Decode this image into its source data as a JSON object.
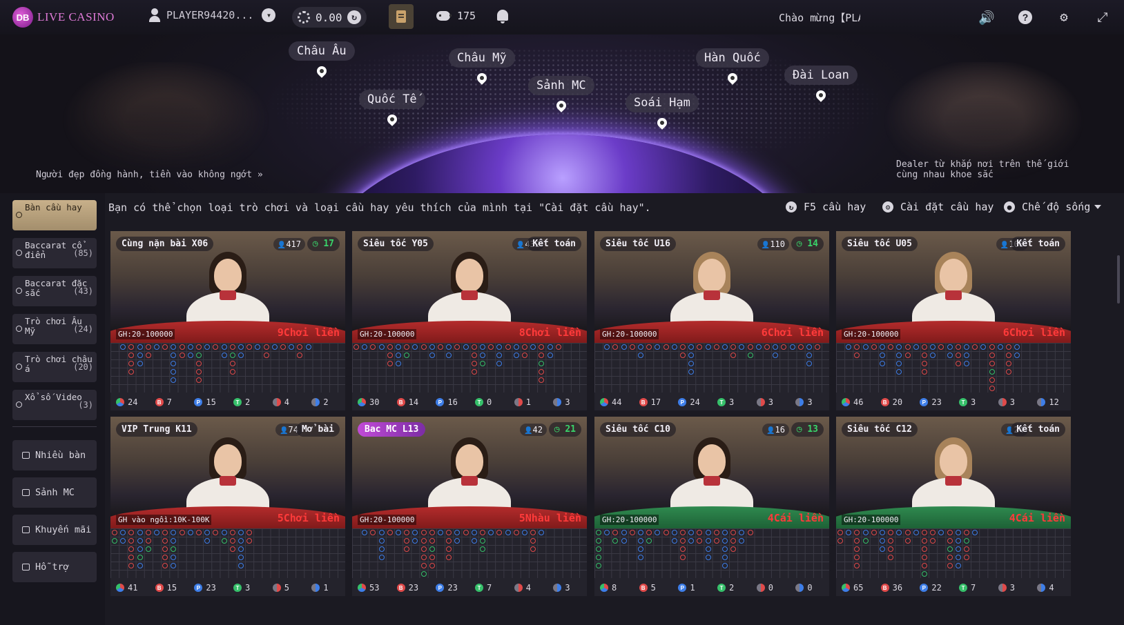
{
  "brand": {
    "logo_mark": "DB",
    "name": "LIVE CASINO"
  },
  "header": {
    "player": "PLAYER94420...",
    "balance": "0.00",
    "messages": "175",
    "welcome": "Chào mừng【PLA"
  },
  "hero": {
    "left_caption": "Người đẹp đồng hành, tiền vào không ngớt",
    "right_caption": "Dealer từ khắp nơi trên thế giới cùng nhau khoe sắc",
    "regions": [
      "Châu Âu",
      "Quốc Tế",
      "Châu Mỹ",
      "Sảnh MC",
      "Soái Hạm",
      "Hàn Quốc",
      "Đài Loan"
    ]
  },
  "sidebar": {
    "categories": [
      {
        "label": "Bàn cầu hay",
        "count": ""
      },
      {
        "label": "Baccarat cổ điển",
        "count": "(85)"
      },
      {
        "label": "Baccarat đặc sắc",
        "count": "(43)"
      },
      {
        "label": "Trò chơi Âu Mỹ",
        "count": "(24)"
      },
      {
        "label": "Trò chơi châu á",
        "count": "(20)"
      },
      {
        "label": "Xổ số Video",
        "count": "(3)"
      }
    ],
    "buttons": [
      "Nhiều bàn",
      "Sảnh MC",
      "Khuyến mãi",
      "Hỗ trợ"
    ]
  },
  "main": {
    "hint": "Bạn có thể chọn loại trò chơi và loại cầu hay yêu thích của mình tại \"Cài đặt cầu hay\".",
    "actions": [
      "F5 cầu hay",
      "Cài đặt cầu hay",
      "Chế độ sống"
    ]
  },
  "tables": [
    {
      "name": "Cùng nặn bài X06",
      "players": "417",
      "status": "17",
      "status_type": "timer",
      "limit": "GH:20-100000",
      "streak": "9Chơi liền",
      "stats": [
        "24",
        "7",
        "15",
        "2",
        "4",
        "2"
      ],
      "felt": "red",
      "hair": "dark"
    },
    {
      "name": "Siêu tốc Y05",
      "players": "432",
      "status": "Kết toán",
      "status_type": "text",
      "limit": "GH:20-100000",
      "streak": "8Chơi liền",
      "stats": [
        "30",
        "14",
        "16",
        "0",
        "1",
        "3"
      ],
      "felt": "red",
      "hair": "dark"
    },
    {
      "name": "Siêu tốc U16",
      "players": "110",
      "status": "14",
      "status_type": "timer",
      "limit": "GH:20-100000",
      "streak": "6Chơi liền",
      "stats": [
        "44",
        "17",
        "24",
        "3",
        "3",
        "3"
      ],
      "felt": "red",
      "hair": "blonde"
    },
    {
      "name": "Siêu tốc U05",
      "players": "108",
      "status": "Kết toán",
      "status_type": "text",
      "limit": "GH:20-100000",
      "streak": "6Chơi liền",
      "stats": [
        "46",
        "20",
        "23",
        "3",
        "3",
        "12"
      ],
      "felt": "red",
      "hair": "blonde"
    },
    {
      "name": "VIP Trung K11",
      "players": "74",
      "status": "Mở bài",
      "status_type": "text",
      "limit": "GH vào ngồi:10K-100K",
      "streak": "5Chơi liền",
      "stats": [
        "41",
        "15",
        "23",
        "3",
        "5",
        "1"
      ],
      "felt": "red",
      "hair": "dark"
    },
    {
      "name": "Bac MC L13",
      "players": "42",
      "status": "21",
      "status_type": "timer",
      "limit": "GH:20-100000",
      "streak": "5Nhàu liền",
      "stats": [
        "53",
        "23",
        "23",
        "7",
        "4",
        "3"
      ],
      "felt": "red",
      "hair": "dark",
      "mc": true
    },
    {
      "name": "Siêu tốc C10",
      "players": "16",
      "status": "13",
      "status_type": "timer",
      "limit": "GH:20-100000",
      "streak": "4Cái liền",
      "stats": [
        "8",
        "5",
        "1",
        "2",
        "0",
        "0"
      ],
      "felt": "green",
      "hair": "dark"
    },
    {
      "name": "Siêu tốc C12",
      "players": "24",
      "status": "Kết toán",
      "status_type": "text",
      "limit": "GH:20-100000",
      "streak": "4Cái liền",
      "stats": [
        "65",
        "36",
        "22",
        "7",
        "3",
        "4"
      ],
      "felt": "green",
      "hair": "blonde"
    }
  ],
  "stat_letters": [
    "",
    "B",
    "P",
    "T",
    "",
    ""
  ],
  "colors": {
    "banker": "#e04a4a",
    "player": "#3e7ee8",
    "tie": "#36c06a",
    "accent": "#c8b08a"
  }
}
